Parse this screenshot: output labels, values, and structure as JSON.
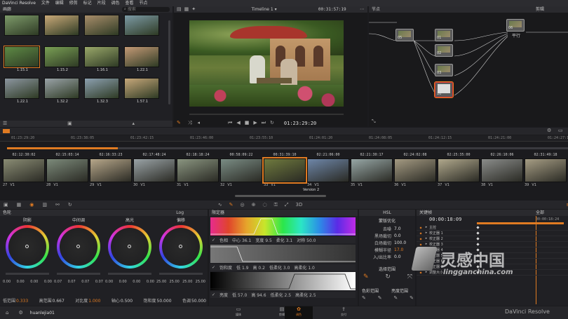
{
  "titlebar": {
    "app": "DaVinci Resolve",
    "menus": [
      "文件",
      "编辑",
      "修剪",
      "标记",
      "片段",
      "调色",
      "查看",
      "节点"
    ]
  },
  "media_pool": {
    "title": "画廊",
    "search_placeholder": "搜索",
    "stills": [
      {
        "label": ""
      },
      {
        "label": ""
      },
      {
        "label": ""
      },
      {
        "label": ""
      },
      {
        "label": "1.15.1"
      },
      {
        "label": "1.15.2"
      },
      {
        "label": "1.16.1"
      },
      {
        "label": "1.22.1"
      },
      {
        "label": "1.22.1"
      },
      {
        "label": "1.32.2"
      },
      {
        "label": "1.32.3"
      },
      {
        "label": "1.57.1"
      }
    ]
  },
  "viewer": {
    "timeline_name": "Timeline 1",
    "timecode_top": "00:31:57:19",
    "timecode": "01:23:29:20"
  },
  "nodes": {
    "title": "节点",
    "mode": "剪辑",
    "output_label": "平行",
    "node_numbers": [
      "05",
      "01",
      "02",
      "03",
      "06",
      "07",
      "10"
    ]
  },
  "ruler": {
    "ticks": [
      "01:23:29:20",
      "01:23:38:05",
      "01:23:42:15",
      "01:23:46:00",
      "01:23:55:10",
      "01:24:01:20",
      "01:24:08:05",
      "01:24:12:15",
      "01:24:21:00",
      "01:24:27:10"
    ]
  },
  "clips": [
    {
      "tc": "02:12:30:02",
      "num": "27",
      "track": "V1",
      "img": "#8a8c74"
    },
    {
      "tc": "02:15:03:14",
      "num": "28",
      "track": "V1",
      "img": "#7c8a7a"
    },
    {
      "tc": "02:16:33:23",
      "num": "29",
      "track": "V1",
      "img": "#b7a78a"
    },
    {
      "tc": "02:17:48:24",
      "num": "30",
      "track": "V1",
      "img": "#9aa3a6"
    },
    {
      "tc": "02:18:18:24",
      "num": "31",
      "track": "V1",
      "img": "#8a9580"
    },
    {
      "tc": "00:58:09:22",
      "num": "32",
      "track": "V1",
      "img": "#7a8c84"
    },
    {
      "tc": "00:31:39:10",
      "num": "33",
      "track": "V1",
      "img": "#6f7a3e"
    },
    {
      "tc": "02:21:06:00",
      "num": "34",
      "track": "V1",
      "img": "#6e86a8"
    },
    {
      "tc": "02:21:30:17",
      "num": "35",
      "track": "V1",
      "img": "#97a7a6"
    },
    {
      "tc": "02:24:02:08",
      "num": "36",
      "track": "V1",
      "img": "#a49a82"
    },
    {
      "tc": "02:25:35:00",
      "num": "37",
      "track": "V1",
      "img": "#b0a88c"
    },
    {
      "tc": "02:26:10:06",
      "num": "38",
      "track": "V1",
      "img": "#8a8c8a"
    },
    {
      "tc": "02:31:49:18",
      "num": "39",
      "track": "V1",
      "img": "#a69d84"
    }
  ],
  "version_label": "Version 2",
  "color_wheels": {
    "title": "色轮",
    "mode": "Log",
    "wheels": [
      {
        "name": "阴影",
        "vals": [
          "0.00",
          "0.00",
          "0.00",
          "0.00"
        ]
      },
      {
        "name": "中间调",
        "vals": [
          "0.07",
          "0.07",
          "0.07",
          "0.07"
        ]
      },
      {
        "name": "高光",
        "vals": [
          "0.00",
          "0.00",
          "0.00",
          "0.00"
        ]
      },
      {
        "name": "偏移",
        "vals": [
          "25.00",
          "25.00",
          "25.00",
          "25.00"
        ]
      }
    ],
    "footer": [
      {
        "label": "低范围",
        "value": "0.333"
      },
      {
        "label": "高范围",
        "value": "0.667"
      },
      {
        "label": "对比度",
        "value": "1.000"
      },
      {
        "label": "轴心",
        "value": "0.500"
      },
      {
        "label": "饱和度",
        "value": "50.000"
      },
      {
        "label": "色调",
        "value": "50.000"
      }
    ]
  },
  "hsl_qualifier": {
    "title": "限定器",
    "hue": {
      "label": "色相",
      "vals": [
        "中心 36.1",
        "宽度 9.5",
        "柔化 3.1",
        "对称 50.0"
      ]
    },
    "sat": {
      "label": "饱和度",
      "vals": [
        "低 1.9",
        "高 0.2",
        "低柔化 3.0",
        "高柔化 1.0"
      ]
    },
    "lum": {
      "label": "亮度",
      "vals": [
        "低 57.0",
        "高 94.6",
        "低柔化 2.5",
        "高柔化 2.5"
      ]
    }
  },
  "hsl_panel": {
    "title": "HSL",
    "subtitle": "蒙版优化",
    "items": [
      {
        "label": "去噪",
        "value": "7.0"
      },
      {
        "label": "黑场裁切",
        "value": "0.0"
      },
      {
        "label": "白场裁切",
        "value": "100.0"
      },
      {
        "label": "模糊半径",
        "value": "17.0"
      },
      {
        "label": "入/出比率",
        "value": "0.0"
      }
    ],
    "section2": "选择范围",
    "section3": "色彩范围",
    "section4": "亮度范围"
  },
  "keyframes": {
    "title": "关键帧",
    "mode": "全部",
    "timecode": "00:00:18:09",
    "end_tc": "00:00:18:24",
    "tracks": [
      "主控",
      "校正器 1",
      "校正器 2",
      "校正器 3",
      "校正器 4",
      "校正器 5",
      "校正器 6",
      "校正器 7",
      "调整大小"
    ]
  },
  "bottom_bar": {
    "project": "huanlejia01",
    "pages": [
      "媒体",
      "剪辑",
      "调色",
      "交付"
    ],
    "brand": "DaVinci Resolve"
  },
  "watermark": {
    "text": "灵感中国",
    "url": "lingganchina.com"
  },
  "colors": {
    "accent": "#e07b22",
    "panel": "#202024",
    "header": "#2a2a2e"
  }
}
